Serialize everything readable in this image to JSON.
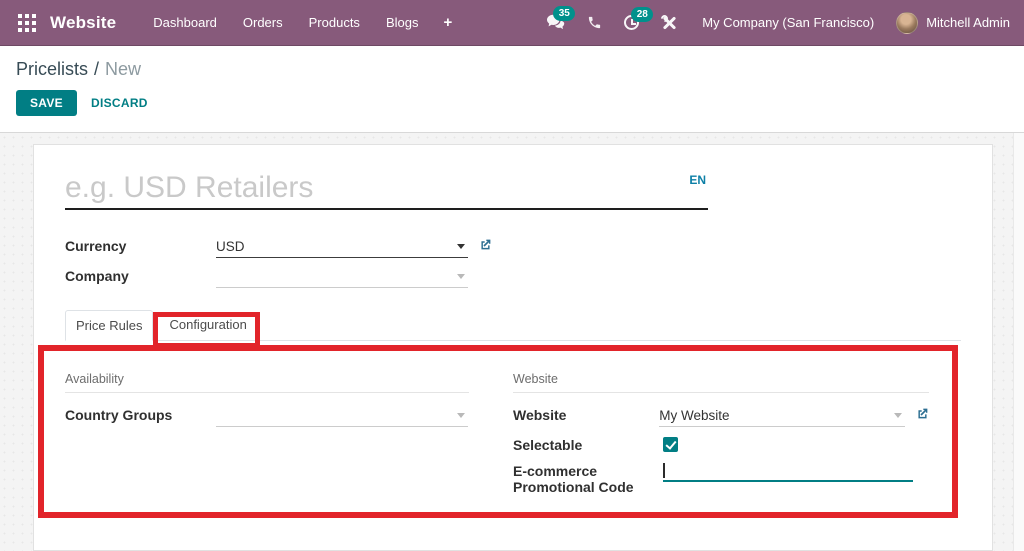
{
  "colors": {
    "navbar_bg": "#875A7B",
    "accent_teal": "#017E84",
    "badge_teal": "#00918C",
    "annotation_red": "#E2242A"
  },
  "navbar": {
    "app_name": "Website",
    "menu_items": [
      "Dashboard",
      "Orders",
      "Products",
      "Blogs"
    ],
    "badges": {
      "messages": "35",
      "activities": "28"
    },
    "company": "My Company (San Francisco)",
    "user": "Mitchell Admin"
  },
  "icons": {
    "add": "+"
  },
  "breadcrumb": {
    "parent": "Pricelists",
    "separator": "/",
    "current": "New"
  },
  "actions": {
    "save": "SAVE",
    "discard": "DISCARD"
  },
  "form": {
    "title_placeholder": "e.g. USD Retailers",
    "language": "EN",
    "fields": {
      "currency": {
        "label": "Currency",
        "value": "USD"
      },
      "company": {
        "label": "Company",
        "value": ""
      }
    },
    "tabs": [
      {
        "label": "Price Rules"
      },
      {
        "label": "Configuration"
      }
    ],
    "configuration": {
      "availability": {
        "heading": "Availability",
        "country_groups_label": "Country Groups",
        "country_groups_value": ""
      },
      "website": {
        "heading": "Website",
        "website_label": "Website",
        "website_value": "My Website",
        "selectable_label": "Selectable",
        "selectable_checked": true,
        "promo_label": "E-commerce Promotional Code",
        "promo_value": ""
      }
    }
  }
}
